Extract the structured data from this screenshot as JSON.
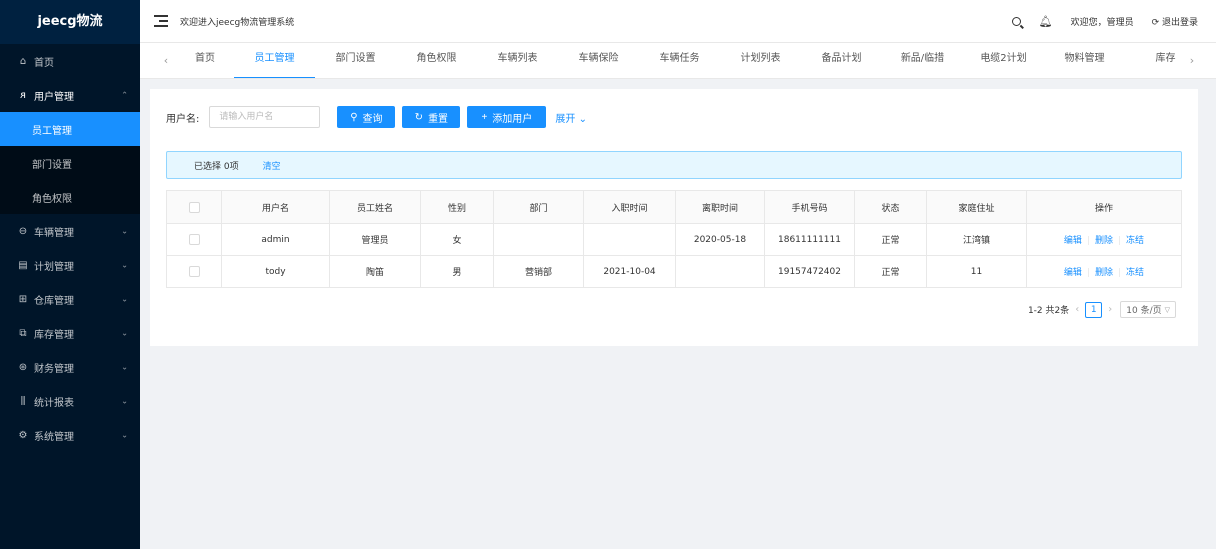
{
  "sidebar": {
    "logo": "jeecg物流",
    "items": [
      {
        "label": "首页",
        "icon": "home-icon",
        "glyph": "⌂"
      },
      {
        "label": "用户管理",
        "icon": "user-icon",
        "glyph": "ᴙ",
        "chevron": "⌃"
      },
      {
        "label": "车辆管理",
        "icon": "car-icon",
        "glyph": "⊖",
        "chevron": "⌄"
      },
      {
        "label": "计划管理",
        "icon": "file-icon",
        "glyph": "▤",
        "chevron": "⌄"
      },
      {
        "label": "仓库管理",
        "icon": "grid-icon",
        "glyph": "⊞",
        "chevron": "⌄"
      },
      {
        "label": "库存管理",
        "icon": "copy-icon",
        "glyph": "⧉",
        "chevron": "⌄"
      },
      {
        "label": "财务管理",
        "icon": "yen-icon",
        "glyph": "⊛",
        "chevron": "⌄"
      },
      {
        "label": "统计报表",
        "icon": "bar-chart-icon",
        "glyph": "⫼",
        "chevron": "⌄"
      },
      {
        "label": "系统管理",
        "icon": "gear-icon",
        "glyph": "⚙",
        "chevron": "⌄"
      }
    ],
    "submenu": [
      "员工管理",
      "部门设置",
      "角色权限"
    ]
  },
  "header": {
    "welcome": "欢迎进入jeecg物流管理系统",
    "greeting": "欢迎您，管理员",
    "logout": "退出登录"
  },
  "tabs": [
    "首页",
    "员工管理",
    "部门设置",
    "角色权限",
    "车辆列表",
    "车辆保险",
    "车辆任务",
    "计划列表",
    "备品计划",
    "新品/临措",
    "电缆2计划",
    "物料管理",
    "库存"
  ],
  "search": {
    "label": "用户名:",
    "placeholder": "请输入用户名",
    "query": "查询",
    "reset": "重置",
    "add": "添加用户",
    "expand": "展开"
  },
  "alert": {
    "selected": "已选择 0项",
    "clear": "清空"
  },
  "table": {
    "columns": [
      "用户名",
      "员工姓名",
      "性别",
      "部门",
      "入职时间",
      "离职时间",
      "手机号码",
      "状态",
      "家庭住址",
      "操作"
    ],
    "rows": [
      {
        "username": "admin",
        "name": "管理员",
        "gender": "女",
        "dept": "",
        "join": "",
        "leave": "2020-05-18",
        "phone": "18611111111",
        "status": "正常",
        "address": "江湾镇"
      },
      {
        "username": "tody",
        "name": "陶笛",
        "gender": "男",
        "dept": "营销部",
        "join": "2021-10-04",
        "leave": "",
        "phone": "19157472402",
        "status": "正常",
        "address": "11"
      }
    ],
    "actions": {
      "edit": "编辑",
      "delete": "删除",
      "freeze": "冻结"
    }
  },
  "pager": {
    "total": "1-2 共2条",
    "page": "1",
    "size": "10 条/页"
  }
}
